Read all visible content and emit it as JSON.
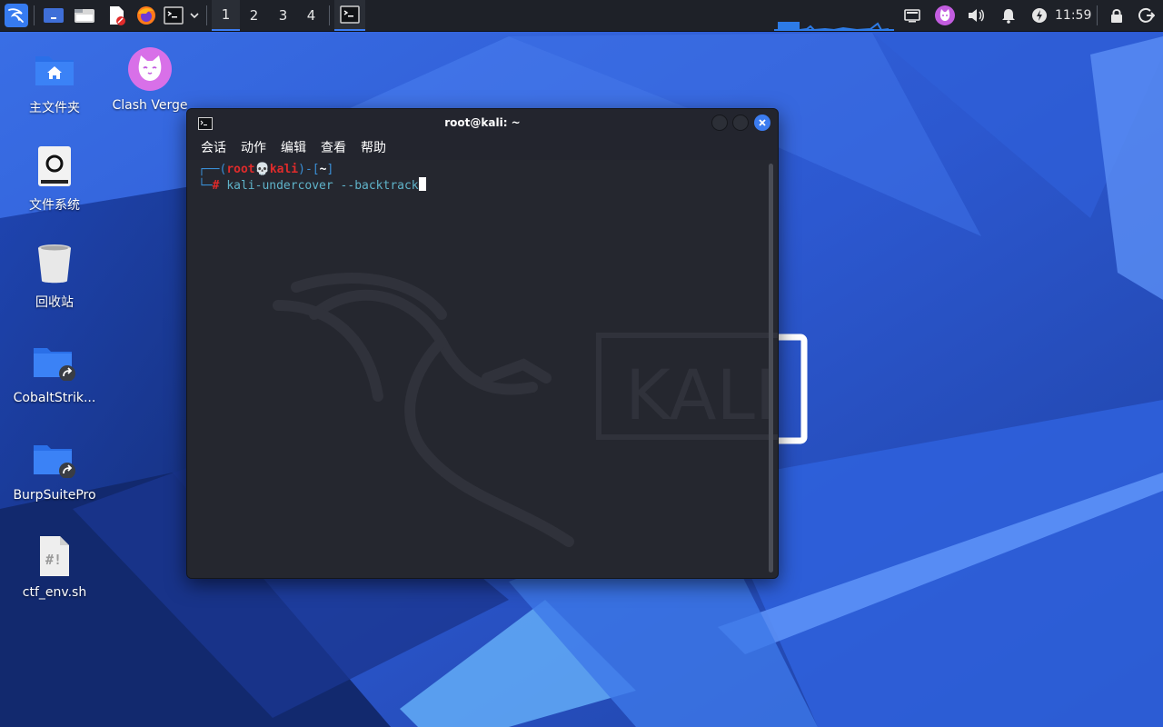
{
  "panel": {
    "workspaces": [
      "1",
      "2",
      "3",
      "4"
    ],
    "active_workspace": "1",
    "clock": "11:59",
    "icons": [
      "kali-menu-icon",
      "show-desktop-icon",
      "file-manager-icon",
      "text-editor-icon",
      "firefox-icon",
      "terminal-icon",
      "chevron-down-icon",
      "terminal-task-icon",
      "display-icon",
      "clash-verge-tray-icon",
      "volume-icon",
      "notifications-icon",
      "power-icon",
      "lock-icon",
      "logout-icon"
    ]
  },
  "desktop": {
    "icons": [
      {
        "label": "主文件夹",
        "icon": "home-folder-icon"
      },
      {
        "label": "Clash Verge",
        "icon": "clash-verge-icon"
      },
      {
        "label": "文件系统",
        "icon": "filesystem-icon"
      },
      {
        "label": "回收站",
        "icon": "trash-icon"
      },
      {
        "label": "CobaltStrik...",
        "icon": "folder-shortcut-icon"
      },
      {
        "label": "BurpSuitePro",
        "icon": "folder-shortcut-icon"
      },
      {
        "label": "ctf_env.sh",
        "icon": "script-file-icon"
      }
    ]
  },
  "terminal": {
    "title": "root@kali: ~",
    "menu": [
      "会话",
      "动作",
      "编辑",
      "查看",
      "帮助"
    ],
    "prompt": {
      "user": "root",
      "host": "kali",
      "cwd": "~",
      "symbol": "#"
    },
    "command": "kali-undercover --backtrack",
    "watermark_text": "KALI"
  },
  "colors": {
    "panel_bg": "#1e2128",
    "terminal_bg": "#25272f",
    "prompt_red": "#e02b2b",
    "prompt_blue": "#3a8fd6",
    "accent": "#3b7cf0"
  }
}
